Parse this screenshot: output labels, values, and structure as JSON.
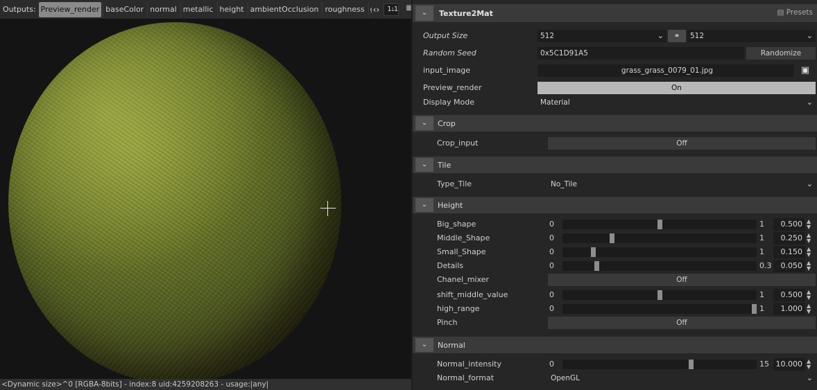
{
  "outputs": {
    "label": "Outputs:",
    "tabs": [
      "Preview_render",
      "baseColor",
      "normal",
      "metallic",
      "height",
      "ambientOcclusion",
      "roughness",
      "g"
    ],
    "active": "Preview_render",
    "zoom": "1:1"
  },
  "status_bar": "<Dynamic size>^0 [RGBA-8bits] - index:8 uid:4259208263 - usage:|any|",
  "node": {
    "title": "Texture2Mat",
    "presets": "Presets",
    "output_size": {
      "label": "Output Size",
      "w": "512",
      "h": "512"
    },
    "random_seed": {
      "label": "Random Seed",
      "value": "0x5C1D91A5",
      "button": "Randomize"
    },
    "input_image": {
      "label": "input_image",
      "value": "grass_grass_0079_01.jpg"
    },
    "preview_render": {
      "label": "Preview_render",
      "value": "On"
    },
    "display_mode": {
      "label": "Display Mode",
      "value": "Material"
    }
  },
  "crop": {
    "title": "Crop",
    "crop_input": {
      "label": "Crop_input",
      "value": "Off"
    }
  },
  "tile": {
    "title": "Tile",
    "type_tile": {
      "label": "Type_Tile",
      "value": "No_Tile"
    }
  },
  "height": {
    "title": "Height",
    "big_shape": {
      "label": "Big_shape",
      "min": "0",
      "max": "1",
      "value": "0.500",
      "frac": 0.5
    },
    "middle_shape": {
      "label": "Middle_Shape",
      "min": "0",
      "max": "1",
      "value": "0.250",
      "frac": 0.25
    },
    "small_shape": {
      "label": "Small_Shape",
      "min": "0",
      "max": "1",
      "value": "0.150",
      "frac": 0.15
    },
    "details": {
      "label": "Details",
      "min": "0",
      "max": "0.3",
      "value": "0.050",
      "frac": 0.1667
    },
    "chanel_mixer": {
      "label": "Chanel_mixer",
      "value": "Off"
    },
    "shift_middle": {
      "label": "shift_middle_value",
      "min": "0",
      "max": "1",
      "value": "0.500",
      "frac": 0.5
    },
    "high_range": {
      "label": "high_range",
      "min": "0",
      "max": "1",
      "value": "1.000",
      "frac": 1.0
    },
    "pinch": {
      "label": "Pinch",
      "value": "Off"
    }
  },
  "normal": {
    "title": "Normal",
    "intensity": {
      "label": "Normal_intensity",
      "min": "0",
      "max": "15",
      "value": "10.000",
      "frac": 0.6667
    },
    "format": {
      "label": "Normal_format",
      "value": "OpenGL"
    }
  }
}
